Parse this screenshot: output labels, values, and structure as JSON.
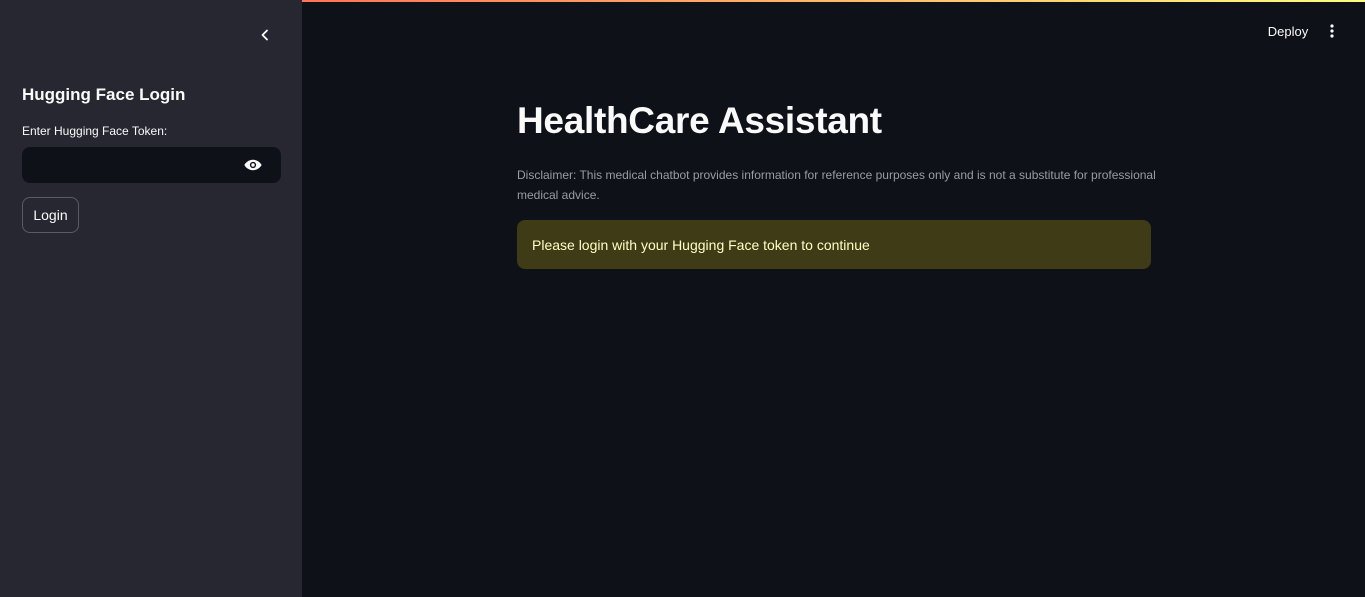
{
  "colors": {
    "background": "#0e1117",
    "sidebar_background": "#262730",
    "text": "#fafafa",
    "muted_text": "#9a9ca3",
    "warning_background": "#3e3b16",
    "warning_text": "#ffffc2",
    "top_bar_gradient_start": "#ff4b4b",
    "top_bar_gradient_end": "#fffd80"
  },
  "toolbar": {
    "deploy_label": "Deploy",
    "menu_icon": "vertical-ellipsis-icon"
  },
  "sidebar": {
    "collapse_icon": "chevron-left-icon",
    "title": "Hugging Face Login",
    "token_label": "Enter Hugging Face Token:",
    "token_value": "",
    "token_placeholder": "",
    "visibility_icon": "eye-icon",
    "login_label": "Login"
  },
  "main": {
    "title": "HealthCare Assistant",
    "disclaimer": "Disclaimer: This medical chatbot provides information for reference purposes only and is not a substitute for professional medical advice.",
    "warning_message": "Please login with your Hugging Face token to continue"
  }
}
